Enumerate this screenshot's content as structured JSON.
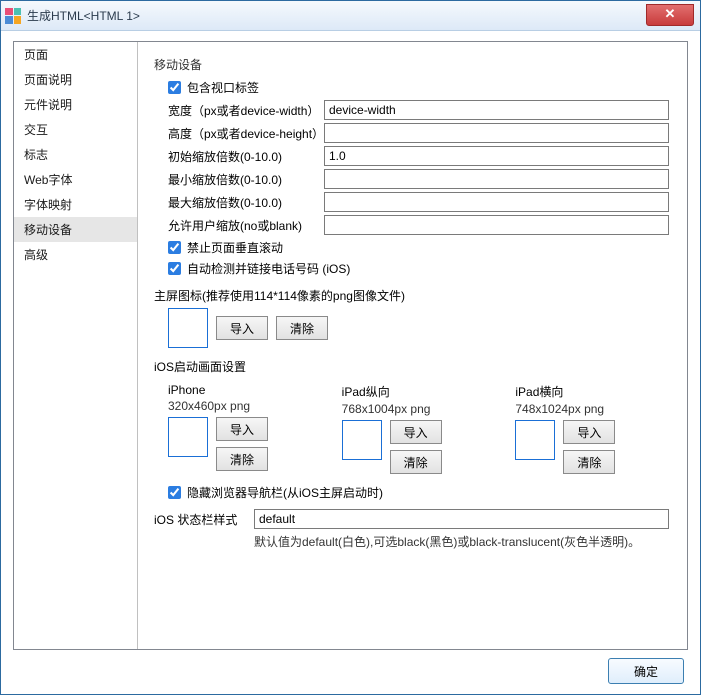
{
  "window": {
    "title": "生成HTML<HTML 1>",
    "close_glyph": "✕"
  },
  "sidebar": {
    "items": [
      {
        "label": "页面"
      },
      {
        "label": "页面说明"
      },
      {
        "label": "元件说明"
      },
      {
        "label": "交互"
      },
      {
        "label": "标志"
      },
      {
        "label": "Web字体"
      },
      {
        "label": "字体映射"
      },
      {
        "label": "移动设备",
        "selected": true
      },
      {
        "label": "高级"
      }
    ]
  },
  "mobile": {
    "group_title": "移动设备",
    "include_viewport": {
      "label": "包含视口标签",
      "checked": true
    },
    "width": {
      "label": "宽度（px或者device-width）",
      "value": "device-width"
    },
    "height": {
      "label": "高度（px或者device-height）",
      "value": ""
    },
    "initial_scale": {
      "label": "初始缩放倍数(0-10.0)",
      "value": "1.0"
    },
    "min_scale": {
      "label": "最小缩放倍数(0-10.0)",
      "value": ""
    },
    "max_scale": {
      "label": "最大缩放倍数(0-10.0)",
      "value": ""
    },
    "user_scalable": {
      "label": "允许用户缩放(no或blank)",
      "value": ""
    },
    "disable_vscroll": {
      "label": "禁止页面垂直滚动",
      "checked": true
    },
    "auto_tel": {
      "label": "自动检测并链接电话号码 (iOS)",
      "checked": true
    },
    "home_icon_label": "主屏图标(推荐使用114*114像素的png图像文件)",
    "import_label": "导入",
    "clear_label": "清除",
    "splash_title": "iOS启动画面设置",
    "splash": [
      {
        "name": "iPhone",
        "spec": "320x460px png"
      },
      {
        "name": "iPad纵向",
        "spec": "768x1004px png"
      },
      {
        "name": "iPad横向",
        "spec": "748x1024px png"
      }
    ],
    "hide_nav": {
      "label": "隐藏浏览器导航栏(从iOS主屏启动时)",
      "checked": true
    },
    "statusbar_label": "iOS 状态栏样式",
    "statusbar_value": "default",
    "statusbar_hint": "默认值为default(白色),可选black(黑色)或black-translucent(灰色半透明)。"
  },
  "footer": {
    "ok_label": "确定"
  }
}
